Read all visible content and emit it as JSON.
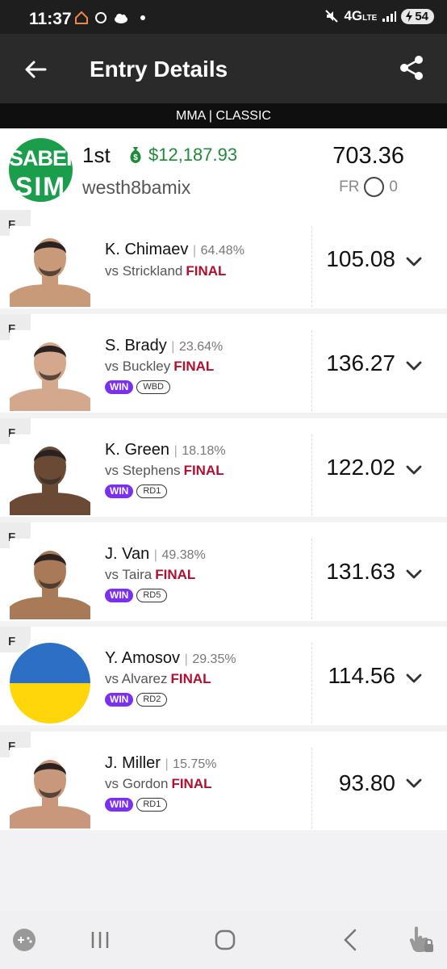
{
  "status_bar": {
    "time": "11:37",
    "network": "4G",
    "network_sub": "LTE",
    "battery": "54"
  },
  "app_bar": {
    "title": "Entry Details"
  },
  "sub_header": "MMA | CLASSIC",
  "entry": {
    "logo_line1": "SABER",
    "logo_line2": "SIM",
    "rank": "1st",
    "winnings": "$12,187.93",
    "username": "westh8bamix",
    "total_score": "703.36",
    "fr_label": "FR",
    "fr_value": "0"
  },
  "players": [
    {
      "pos": "F",
      "name": "K. Chimaev",
      "own": "64.48%",
      "opponent": "vs Strickland",
      "status": "FINAL",
      "result": "",
      "round": "",
      "score": "105.08"
    },
    {
      "pos": "F",
      "name": "S. Brady",
      "own": "23.64%",
      "opponent": "vs Buckley",
      "status": "FINAL",
      "result": "WIN",
      "round": "WBD",
      "score": "136.27"
    },
    {
      "pos": "F",
      "name": "K. Green",
      "own": "18.18%",
      "opponent": "vs Stephens",
      "status": "FINAL",
      "result": "WIN",
      "round": "RD1",
      "score": "122.02"
    },
    {
      "pos": "F",
      "name": "J. Van",
      "own": "49.38%",
      "opponent": "vs Taira",
      "status": "FINAL",
      "result": "WIN",
      "round": "RD5",
      "score": "131.63"
    },
    {
      "pos": "F",
      "name": "Y. Amosov",
      "own": "29.35%",
      "opponent": "vs Alvarez",
      "status": "FINAL",
      "result": "WIN",
      "round": "RD2",
      "score": "114.56"
    },
    {
      "pos": "F",
      "name": "J. Miller",
      "own": "15.75%",
      "opponent": "vs Gordon",
      "status": "FINAL",
      "result": "WIN",
      "round": "RD1",
      "score": "93.80"
    }
  ],
  "colors": {
    "accent_purple": "#7b2ff0",
    "final_red": "#b01030",
    "money_green": "#1e8a3a",
    "logo_green": "#1a9e4b"
  }
}
